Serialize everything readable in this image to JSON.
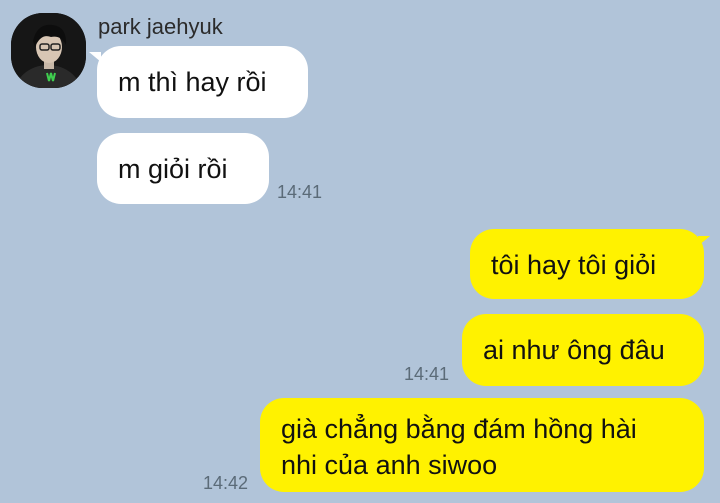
{
  "colors": {
    "background": "#b1c4d9",
    "incoming_bubble": "#ffffff",
    "outgoing_bubble": "#fff200",
    "timestamp": "#5b6b78"
  },
  "sender": {
    "name": "park jaehyuk",
    "avatar_icon": "user-avatar-photo"
  },
  "incoming": [
    {
      "text": "m thì hay rồi"
    },
    {
      "text": "m giỏi rồi",
      "time": "14:41"
    }
  ],
  "outgoing": [
    {
      "text": "tôi hay tôi giỏi"
    },
    {
      "text": "ai như ông đâu",
      "time": "14:41"
    },
    {
      "line1": "già chẳng bằng đám hồng hài",
      "line2": "nhi của anh siwoo",
      "time": "14:42"
    }
  ]
}
